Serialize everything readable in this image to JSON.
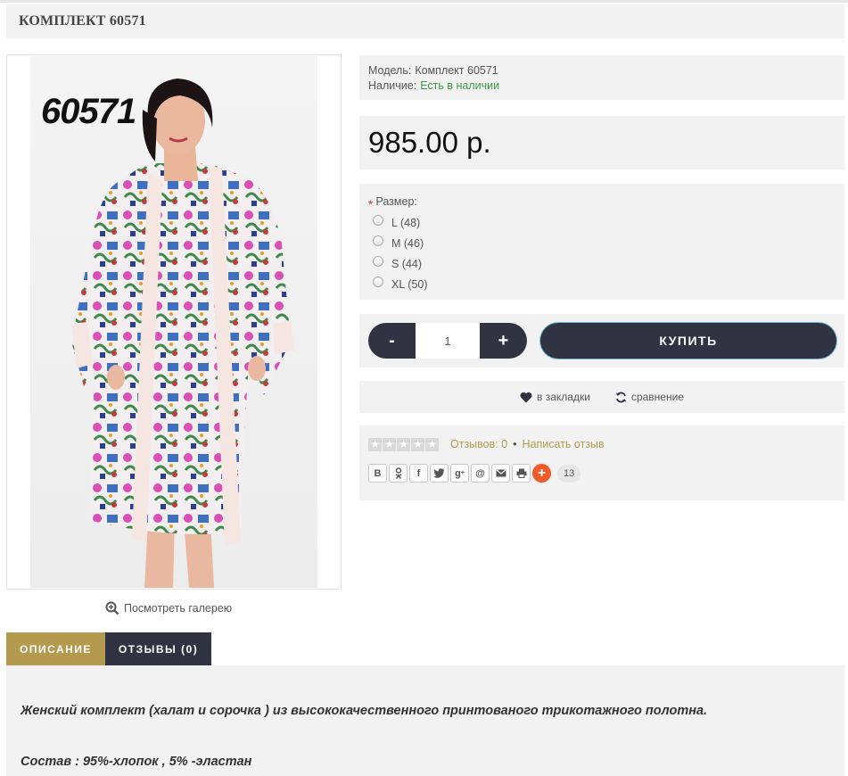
{
  "product": {
    "title": "КОМПЛЕКТ 60571",
    "image_code": "60571",
    "model_label": "Модель:",
    "model_value": "Комплект 60571",
    "availability_label": "Наличие:",
    "availability_value": "Есть в наличии",
    "price": "985.00 р."
  },
  "gallery": {
    "label": "Посмотреть галерею"
  },
  "options": {
    "size_label": "Размер:",
    "required_mark": "*",
    "sizes": [
      "L (48)",
      "M (46)",
      "S (44)",
      "XL (50)"
    ]
  },
  "purchase": {
    "minus": "-",
    "plus": "+",
    "quantity": "1",
    "buy_label": "КУПИТЬ"
  },
  "actions": {
    "wishlist_label": "в закладки",
    "compare_label": "сравнение"
  },
  "reviews": {
    "rating": 0,
    "count_text": "Отзывов: 0",
    "separator": "•",
    "write_text": "Написать отзыв",
    "share_count": "13"
  },
  "share_icons": [
    "vk-icon",
    "odnoklassniki-icon",
    "facebook-icon",
    "twitter-icon",
    "googleplus-icon",
    "mailru-icon",
    "email-icon",
    "print-icon"
  ],
  "tabs": {
    "description": "ОПИСАНИЕ",
    "reviews": "ОТЗЫВЫ (0)"
  },
  "description": {
    "line1": "Женский комплект (халат и сорочка ) из высококачественного принтованого трикотажного полотна.",
    "line2": "Состав : 95%-хлопок , 5% -эластан"
  },
  "colors": {
    "accent_gold": "#b49a4e",
    "dark_button": "#2f3342",
    "in_stock_green": "#3a9a48",
    "panel_bg": "#f2f2f2"
  }
}
